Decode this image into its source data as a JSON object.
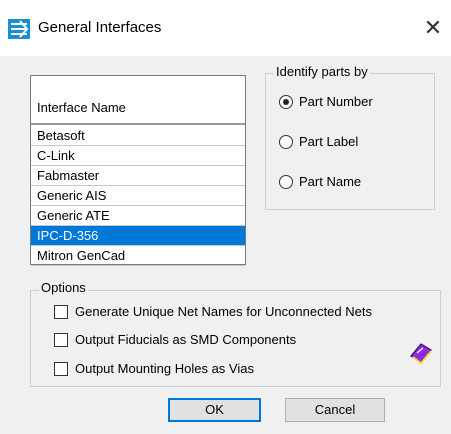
{
  "window": {
    "title": "General Interfaces",
    "close_glyph": "✕",
    "app_icon": "general-interfaces-icon"
  },
  "list": {
    "header": "Interface Name",
    "items": [
      {
        "label": "Betasoft",
        "selected": false
      },
      {
        "label": "C-Link",
        "selected": false
      },
      {
        "label": "Fabmaster",
        "selected": false
      },
      {
        "label": "Generic AIS",
        "selected": false
      },
      {
        "label": "Generic ATE",
        "selected": false
      },
      {
        "label": "IPC-D-356",
        "selected": true
      },
      {
        "label": "Mitron GenCad",
        "selected": false
      }
    ]
  },
  "identify": {
    "legend": "Identify parts by",
    "options": [
      {
        "label": "Part Number",
        "checked": true
      },
      {
        "label": "Part Label",
        "checked": false
      },
      {
        "label": "Part Name",
        "checked": false
      }
    ]
  },
  "options": {
    "legend": "Options",
    "items": [
      {
        "label": "Generate Unique Net Names for Unconnected Nets",
        "checked": false
      },
      {
        "label": "Output Fiducials as SMD Components",
        "checked": false
      },
      {
        "label": "Output Mounting Holes as Vias",
        "checked": false
      }
    ]
  },
  "buttons": {
    "ok": "OK",
    "cancel": "Cancel",
    "help_icon": "help-book-icon"
  },
  "colors": {
    "selection": "#0078d7",
    "default_button_border": "#0078d7"
  }
}
